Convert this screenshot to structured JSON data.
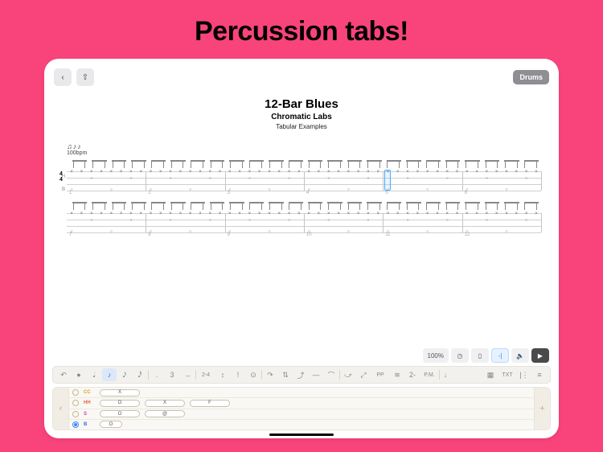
{
  "promo_title": "Percussion tabs!",
  "topbar": {
    "back_icon": "‹",
    "share_icon": "⇧",
    "drums_label": "Drums"
  },
  "document": {
    "title": "12-Bar Blues",
    "artist": "Chromatic Labs",
    "group": "Tabular Examples"
  },
  "tempo": {
    "rhythm": "♫♪♪",
    "bpm": "100bpm"
  },
  "timesig": {
    "num": "4",
    "den": "4"
  },
  "tab_lane_labels": {
    "top": "H",
    "bot": "B"
  },
  "bars": {
    "row1": [
      1,
      2,
      3,
      4,
      5,
      6
    ],
    "row2": [
      7,
      8,
      9,
      10,
      11,
      12
    ]
  },
  "playback": {
    "zoom": "100%",
    "clock": "◷",
    "metronome": "▯",
    "count_in": "-|",
    "speaker": "🔈",
    "play": "▶"
  },
  "toolbar": {
    "items": [
      "↶",
      "●",
      "𝅘𝅥",
      "♪",
      "𝅘𝅥𝅯",
      "𝅘𝅥𝅰",
      ".",
      "3",
      "→",
      "2-4",
      "↕",
      "!",
      "⊙",
      "↷",
      "⇅",
      "⤴",
      "—",
      "⌒",
      "⤻",
      "⤢",
      "PP",
      "≋",
      "2-",
      "P.M.",
      "♩",
      "▦",
      "TXT",
      "|⋮",
      "≡"
    ]
  },
  "selected_tool_index": 3,
  "editor": {
    "left_arrow": "‹",
    "right_arrow": "+",
    "lanes": [
      {
        "name": "CC",
        "class": "cc",
        "selected": false,
        "cells": [
          {
            "w": "w",
            "t": "X"
          }
        ]
      },
      {
        "name": "HH",
        "class": "hh",
        "selected": false,
        "cells": [
          {
            "w": "w",
            "t": "O"
          },
          {
            "w": "w",
            "t": "X"
          },
          {
            "w": "w",
            "t": "F"
          }
        ]
      },
      {
        "name": "S",
        "class": "s",
        "selected": false,
        "cells": [
          {
            "w": "w",
            "t": "O"
          },
          {
            "w": "w",
            "t": "@"
          }
        ]
      },
      {
        "name": "B",
        "class": "b",
        "selected": true,
        "cells": [
          {
            "w": "n",
            "t": "O"
          }
        ]
      }
    ]
  }
}
